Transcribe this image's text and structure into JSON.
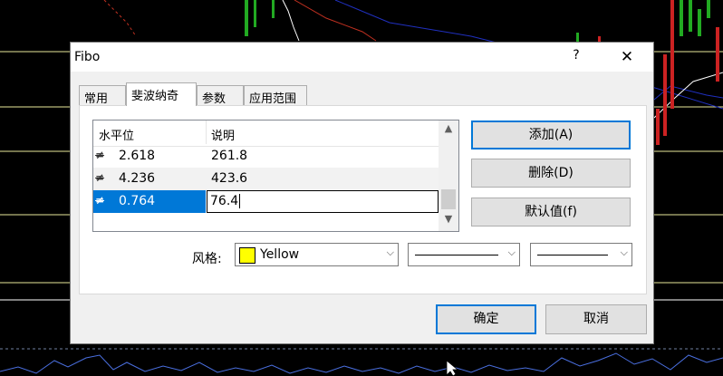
{
  "dialog": {
    "title": "Fibo",
    "help": "?",
    "close": "✕",
    "tabs": [
      {
        "label": "常用"
      },
      {
        "label": "斐波纳奇"
      },
      {
        "label": "参数"
      },
      {
        "label": "应用范围"
      }
    ],
    "columns": {
      "level": "水平位",
      "desc": "说明"
    },
    "rows": [
      {
        "icon": "≠",
        "level": "2.618",
        "desc": "261.8"
      },
      {
        "icon": "≠",
        "level": "4.236",
        "desc": "423.6"
      },
      {
        "icon": "≠",
        "level": "0.764",
        "desc": "76.4"
      }
    ],
    "buttons": {
      "add": "添加(A)",
      "delete": "删除(D)",
      "default": "默认值(f)",
      "ok": "确定",
      "cancel": "取消"
    },
    "style": {
      "label": "风格:",
      "color_name": "Yellow",
      "color": "#ffff00"
    }
  },
  "scroll_arrows": {
    "up": "▲",
    "down": "▼"
  },
  "combo_arrow": "⌵"
}
